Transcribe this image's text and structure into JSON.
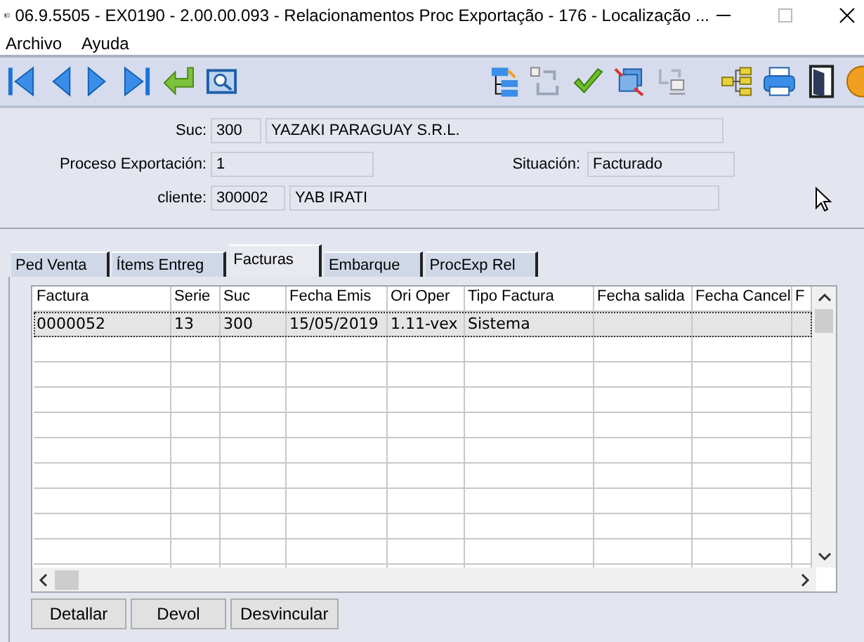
{
  "window": {
    "title": "06.9.5505 - EX0190 - 2.00.00.093 - Relacionamentos Proc Exportação - 176 - Localização ..."
  },
  "menu": [
    "Archivo",
    "Ayuda"
  ],
  "form": {
    "suc_label": "Suc:",
    "suc_code": "300",
    "suc_name": "YAZAKI PARAGUAY S.R.L.",
    "proceso_label": "Proceso Exportación:",
    "proceso": "1",
    "situacion_label": "Situación:",
    "situacion": "Facturado",
    "cliente_label": "cliente:",
    "cliente_code": "300002",
    "cliente_name": "YAB IRATI"
  },
  "tabs": [
    {
      "label": "Ped Venta",
      "selected": false
    },
    {
      "label": "Ítems Entreg",
      "selected": false
    },
    {
      "label": "Facturas",
      "selected": true
    },
    {
      "label": "Embarque",
      "selected": false
    },
    {
      "label": "ProcExp Rel",
      "selected": false
    }
  ],
  "table": {
    "columns": [
      "Factura",
      "Serie",
      "Suc",
      "Fecha Emis",
      "Ori Oper",
      "Tipo Factura",
      "Fecha salida",
      "Fecha Cancel",
      "F"
    ],
    "rows": [
      {
        "selected": true,
        "cells": [
          "0000052",
          "13",
          "300",
          "15/05/2019",
          "1.11-vex",
          "Sistema",
          "",
          "",
          ""
        ]
      }
    ]
  },
  "buttons": [
    "Detallar",
    "Devol",
    "Desvincular"
  ]
}
